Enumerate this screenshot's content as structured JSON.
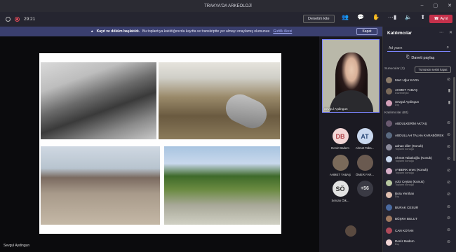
{
  "window": {
    "title": "TRAKYA'DA ARKEOLOJİ",
    "controls": [
      "–",
      "▢",
      "✕"
    ]
  },
  "toolbar": {
    "timer": "29:21",
    "focus_button": "Denetim kite",
    "leave_label": "Ayrıl",
    "accent": "#c4314b"
  },
  "banner": {
    "text_bold": "Kayıt ve döküm başlatıldı.",
    "text": "Bu toplantıya katıldığınızda kayıtta ve transkriptte yer almayı onaylamış olursunuz.",
    "link": "Gizlilik ilkesi",
    "close_label": "Kapat"
  },
  "stage": {
    "presenter": "Sevgul Aydingun"
  },
  "spotlight": {
    "name": "Sevgul Aydingun"
  },
  "gallery": {
    "tiles": [
      {
        "initials": "DB",
        "name": "Deniz Badem",
        "bg": "#f3d6d6",
        "fg": "#b0454b"
      },
      {
        "initials": "AT",
        "name": "Ahmet Taba...",
        "bg": "#c9d8ee",
        "fg": "#2c4a78"
      },
      {
        "initials": "",
        "name": "AHMET YABAŞ",
        "bg": "#7a6a5a",
        "fg": "#fff"
      },
      {
        "initials": "",
        "name": "ÖMER FAR...",
        "bg": "#6a5a50",
        "fg": "#fff"
      },
      {
        "initials": "SÖ",
        "name": "Sercan Ötk...",
        "bg": "#e2e2e2",
        "fg": "#333"
      },
      {
        "initials": "+56",
        "name": "",
        "bg": "#3a3a44",
        "fg": "#ddd"
      }
    ]
  },
  "panel": {
    "title": "Katılımcılar",
    "search_placeholder": "Ad yazın",
    "share_label": "Daveti paylaş",
    "presenters_label": "Sunucular (3)",
    "mute_all": "Tümünün sesini kapat",
    "attendees_label": "Katılımcılar (60)",
    "presenters": [
      {
        "name": "Mert Uğur KARA",
        "sub": "",
        "color": "#8a7a6a"
      },
      {
        "name": "AHMET YABAŞ",
        "sub": "Düzenleyici",
        "color": "#7a6a5a"
      },
      {
        "name": "Sevgul Aydingun",
        "sub": "Dış",
        "color": "#d4a0b8"
      }
    ],
    "attendees": [
      {
        "name": "ABDULKERİM AKTAŞ",
        "sub": "",
        "color": "#6a5a70"
      },
      {
        "name": "ABDULLAH TALHA KARABÖREK",
        "sub": "",
        "color": "#5a6a80"
      },
      {
        "name": "adnan diler (Konuk)",
        "sub": "Toplantı konuğu",
        "color": "#8a8a9a"
      },
      {
        "name": "Ahmet Tabakoğlu (Konuk)",
        "sub": "Toplantı konuğu",
        "color": "#c9d8ee"
      },
      {
        "name": "AYBERK enes (Konuk)",
        "sub": "Toplantı konuğu",
        "color": "#d8b0c8"
      },
      {
        "name": "Aziz Ceylan (Konuk)",
        "sub": "Toplantı konuğu",
        "color": "#b8c8a0"
      },
      {
        "name": "Bora Yenihan",
        "sub": "Dış",
        "color": "#e0c0b0"
      },
      {
        "name": "BURAK CESUR",
        "sub": "",
        "color": "#4a6aa0"
      },
      {
        "name": "BÜŞRA BULUT",
        "sub": "",
        "color": "#a07a60"
      },
      {
        "name": "CAN KOTAN",
        "sub": "",
        "color": "#b04a5a"
      },
      {
        "name": "Deniz Badem",
        "sub": "Dış",
        "color": "#f3d6d6"
      }
    ]
  }
}
